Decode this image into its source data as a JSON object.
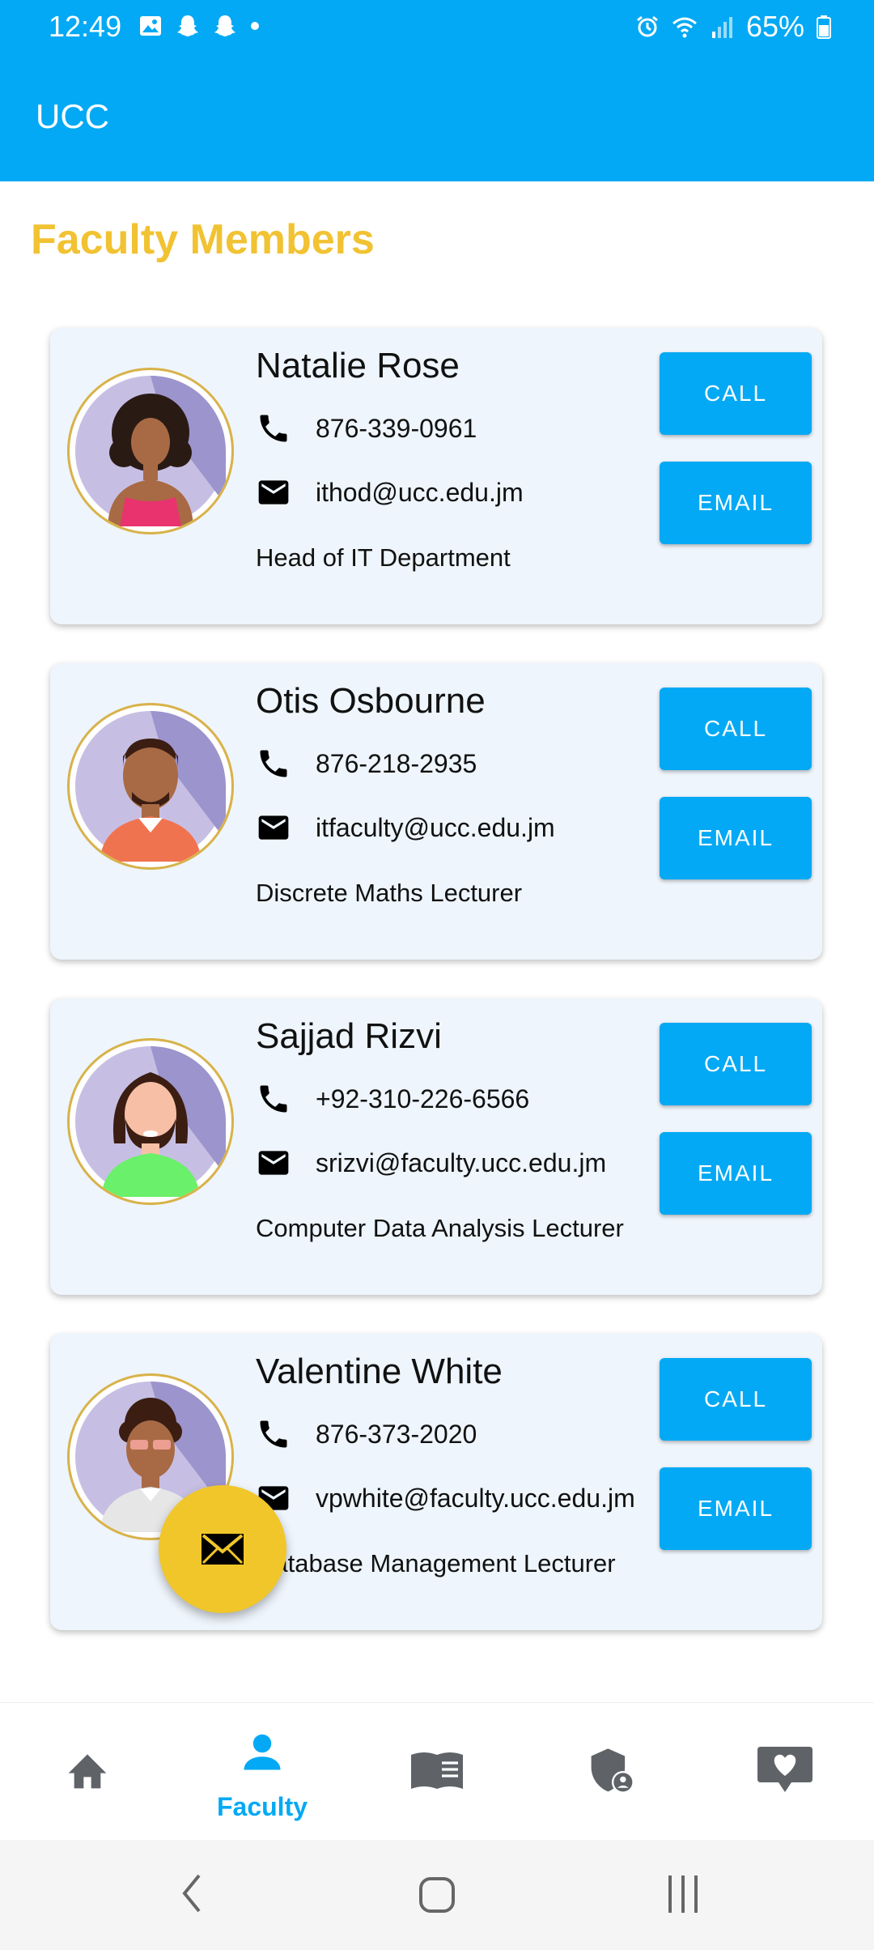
{
  "status_bar": {
    "time": "12:49",
    "battery": "65%"
  },
  "app_bar": {
    "title": "UCC"
  },
  "page": {
    "heading": "Faculty Members"
  },
  "faculty": [
    {
      "name": "Natalie Rose",
      "phone": "876-339-0961",
      "email": "ithod@ucc.edu.jm",
      "role": "Head of IT Department"
    },
    {
      "name": "Otis Osbourne",
      "phone": "876-218-2935",
      "email": "itfaculty@ucc.edu.jm",
      "role": "Discrete Maths Lecturer"
    },
    {
      "name": "Sajjad Rizvi",
      "phone": "+92-310-226-6566",
      "email": "srizvi@faculty.ucc.edu.jm",
      "role": "Computer Data Analysis Lecturer"
    },
    {
      "name": "Valentine White",
      "phone": "876-373-2020",
      "email": "vpwhite@faculty.ucc.edu.jm",
      "role": "Database Management Lecturer"
    }
  ],
  "buttons": {
    "call": "CALL",
    "email": "EMAIL"
  },
  "bottom_nav": {
    "items": [
      {
        "icon": "home-icon"
      },
      {
        "icon": "person-icon",
        "label": "Faculty",
        "active": true
      },
      {
        "icon": "book-icon"
      },
      {
        "icon": "admin-shield-icon"
      },
      {
        "icon": "heart-message-icon"
      }
    ]
  },
  "colors": {
    "primary": "#03a9f4",
    "accent": "#f1c232",
    "card": "#eef5fc"
  }
}
